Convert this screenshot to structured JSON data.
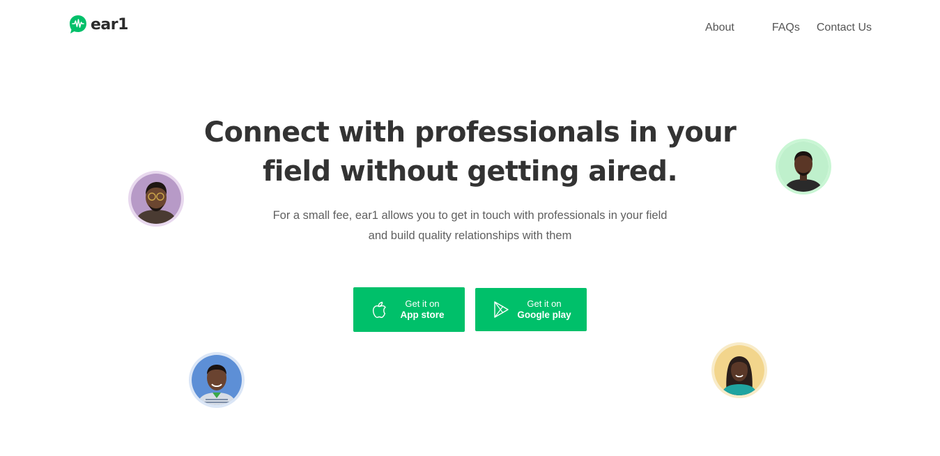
{
  "brand": {
    "name": "ear1",
    "icon": "speech-bubble-waveform-icon",
    "color": "#00c06a"
  },
  "nav": {
    "items": [
      "About",
      "FAQs",
      "Contact Us"
    ]
  },
  "hero": {
    "title_lines": [
      "Connect with professionals in your",
      "field without getting aired."
    ],
    "subtitle_lines": [
      "For a small fee, ear1 allows you to get in touch with professionals in your field",
      "and build quality relationships with them"
    ]
  },
  "downloads": {
    "app_store": {
      "top": "Get it on",
      "bottom": "App store",
      "icon": "apple-icon"
    },
    "google_play": {
      "top": "Get it on",
      "bottom": "Google play",
      "icon": "play-store-icon"
    },
    "button_color": "#00c06a"
  },
  "avatars": [
    {
      "name": "avatar-man-glasses",
      "ring": "#e8d8ee",
      "bg": "#b79ac7"
    },
    {
      "name": "avatar-man-green",
      "ring": "#c9f6d4",
      "bg": "#bff0cc"
    },
    {
      "name": "avatar-man-blue",
      "ring": "#dbe6f6",
      "bg": "#5d8fd6"
    },
    {
      "name": "avatar-woman-yellow",
      "ring": "#f8ebc8",
      "bg": "#f2d58c"
    }
  ]
}
